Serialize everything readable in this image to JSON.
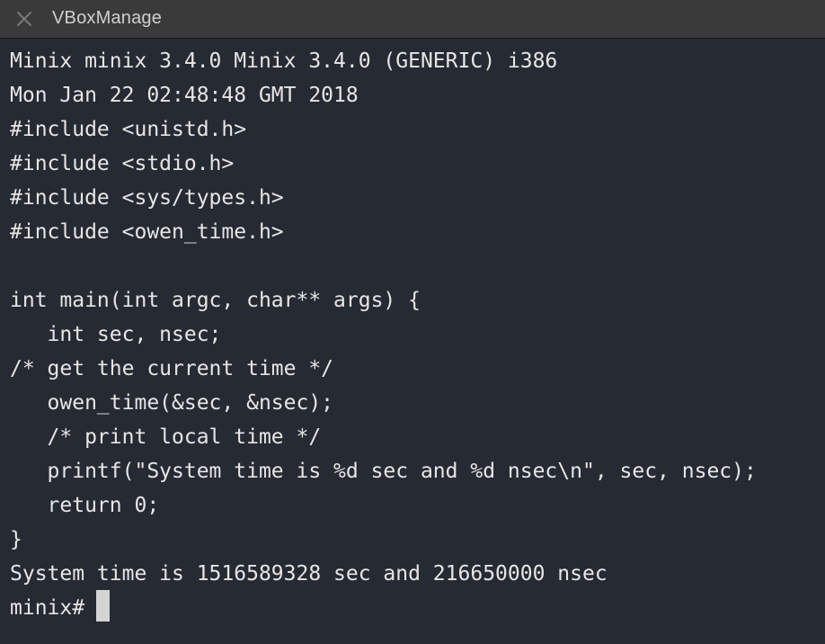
{
  "window": {
    "title": "VBoxManage",
    "close_icon": "close-icon"
  },
  "terminal": {
    "lines": [
      "Minix minix 3.4.0 Minix 3.4.0 (GENERIC) i386",
      "Mon Jan 22 02:48:48 GMT 2018",
      "#include <unistd.h>",
      "#include <stdio.h>",
      "#include <sys/types.h>",
      "#include <owen_time.h>",
      "",
      "int main(int argc, char** args) {",
      "   int sec, nsec;",
      "/* get the current time */",
      "   owen_time(&sec, &nsec);",
      "   /* print local time */",
      "   printf(\"System time is %d sec and %d nsec\\n\", sec, nsec);",
      "   return 0;",
      "}",
      "System time is 1516589328 sec and 216650000 nsec",
      "minix# "
    ],
    "colors": {
      "background": "#262a33",
      "foreground": "#e6e6e6",
      "cursor": "#d4d4d4"
    }
  }
}
